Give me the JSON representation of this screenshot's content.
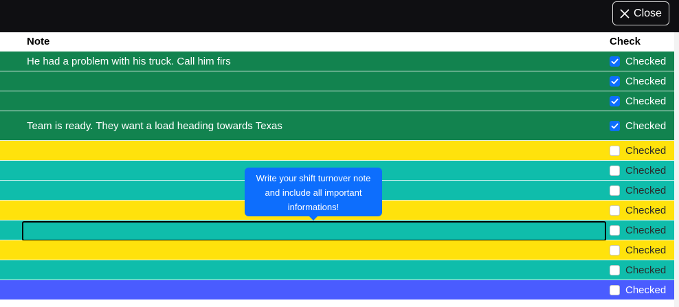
{
  "toolbar": {
    "close_label": "Close",
    "close_icon": "close-icon"
  },
  "table": {
    "headers": {
      "note": "Note",
      "check": "Check"
    },
    "rows": [
      {
        "note": "He had a problem with his truck. Call him firs",
        "check_label": "Checked",
        "checked": true,
        "color": "#12834f",
        "tone": "dark"
      },
      {
        "note": "",
        "check_label": "Checked",
        "checked": true,
        "color": "#12834f",
        "tone": "dark"
      },
      {
        "note": "",
        "check_label": "Checked",
        "checked": true,
        "color": "#12834f",
        "tone": "dark"
      },
      {
        "note": "Team is ready. They want a load heading towards Texas",
        "check_label": "Checked",
        "checked": true,
        "color": "#12834f",
        "tone": "dark"
      },
      {
        "note": "",
        "check_label": "Checked",
        "checked": false,
        "color": "#ffe20c",
        "tone": "light"
      },
      {
        "note": "",
        "check_label": "Checked",
        "checked": false,
        "color": "#0fbdab",
        "tone": "light"
      },
      {
        "note": "",
        "check_label": "Checked",
        "checked": false,
        "color": "#0fbdab",
        "tone": "light"
      },
      {
        "note": "",
        "check_label": "Checked",
        "checked": false,
        "color": "#ffe20c",
        "tone": "light"
      },
      {
        "note": "",
        "check_label": "Checked",
        "checked": false,
        "color": "#0fbdab",
        "tone": "light",
        "editing": true
      },
      {
        "note": "",
        "check_label": "Checked",
        "checked": false,
        "color": "#ffe20c",
        "tone": "light"
      },
      {
        "note": "",
        "check_label": "Checked",
        "checked": false,
        "color": "#0fbdab",
        "tone": "light"
      },
      {
        "note": "",
        "check_label": "Checked",
        "checked": false,
        "color": "#4a5cff",
        "tone": "blue"
      }
    ]
  },
  "tooltip": {
    "text": "Write your shift turnover note and include all important informations!"
  },
  "colors": {
    "topbar": "#0f0f12",
    "checkbox_checked": "#0d6efd",
    "tooltip_bg": "#0d6efd"
  }
}
